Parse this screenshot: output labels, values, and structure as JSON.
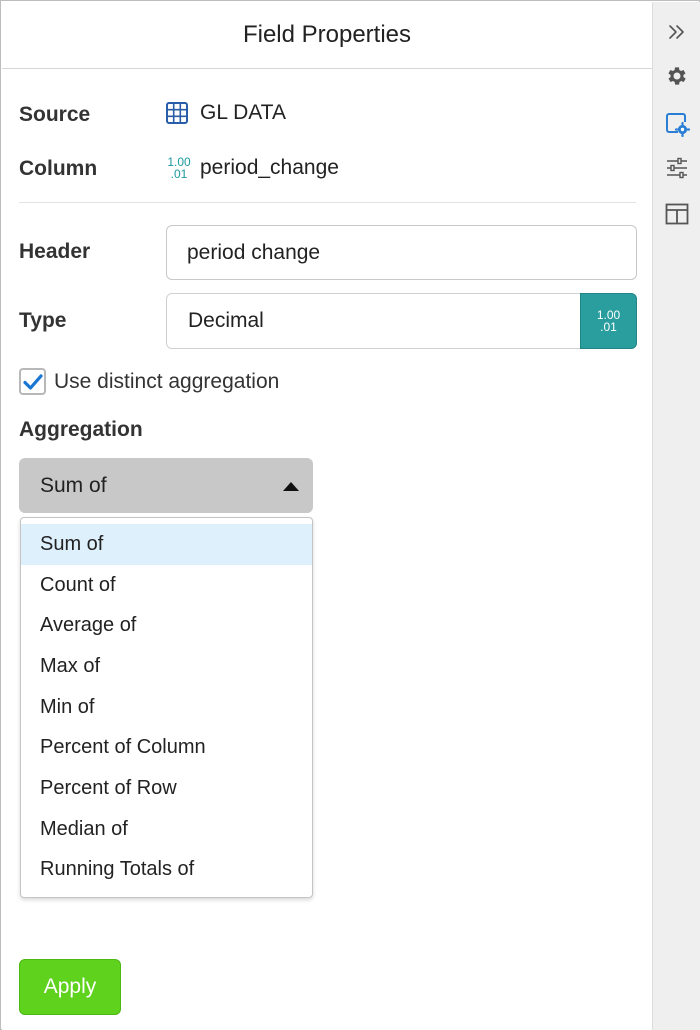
{
  "panel": {
    "title": "Field Properties"
  },
  "info": {
    "source_label": "Source",
    "source_value": "GL DATA",
    "column_label": "Column",
    "column_value": "period_change",
    "numeric_icon_top": "1.00",
    "numeric_icon_bottom": ".01"
  },
  "form": {
    "header_label": "Header",
    "header_value": "period change",
    "type_label": "Type",
    "type_value": "Decimal",
    "type_icon_top": "1.00",
    "type_icon_bottom": ".01",
    "distinct_label": "Use distinct aggregation",
    "distinct_checked": true,
    "aggregation_label": "Aggregation",
    "aggregation_selected": "Sum of",
    "aggregation_options": [
      "Sum of",
      "Count of",
      "Average of",
      "Max of",
      "Min of",
      "Percent of Column",
      "Percent of Row",
      "Median of",
      "Running Totals of"
    ],
    "apply_label": "Apply"
  },
  "toolbar": {
    "icons": [
      "double-chevron-right-icon",
      "gear-icon",
      "field-settings-icon",
      "sliders-icon",
      "layout-icon"
    ],
    "active_icon": "field-settings-icon"
  },
  "colors": {
    "accent": "#2a9d9f",
    "checkbox": "#1976d2",
    "apply": "#5fd21e",
    "selected_option": "#dff0fd",
    "toolbar_active": "#2a7fd4"
  }
}
